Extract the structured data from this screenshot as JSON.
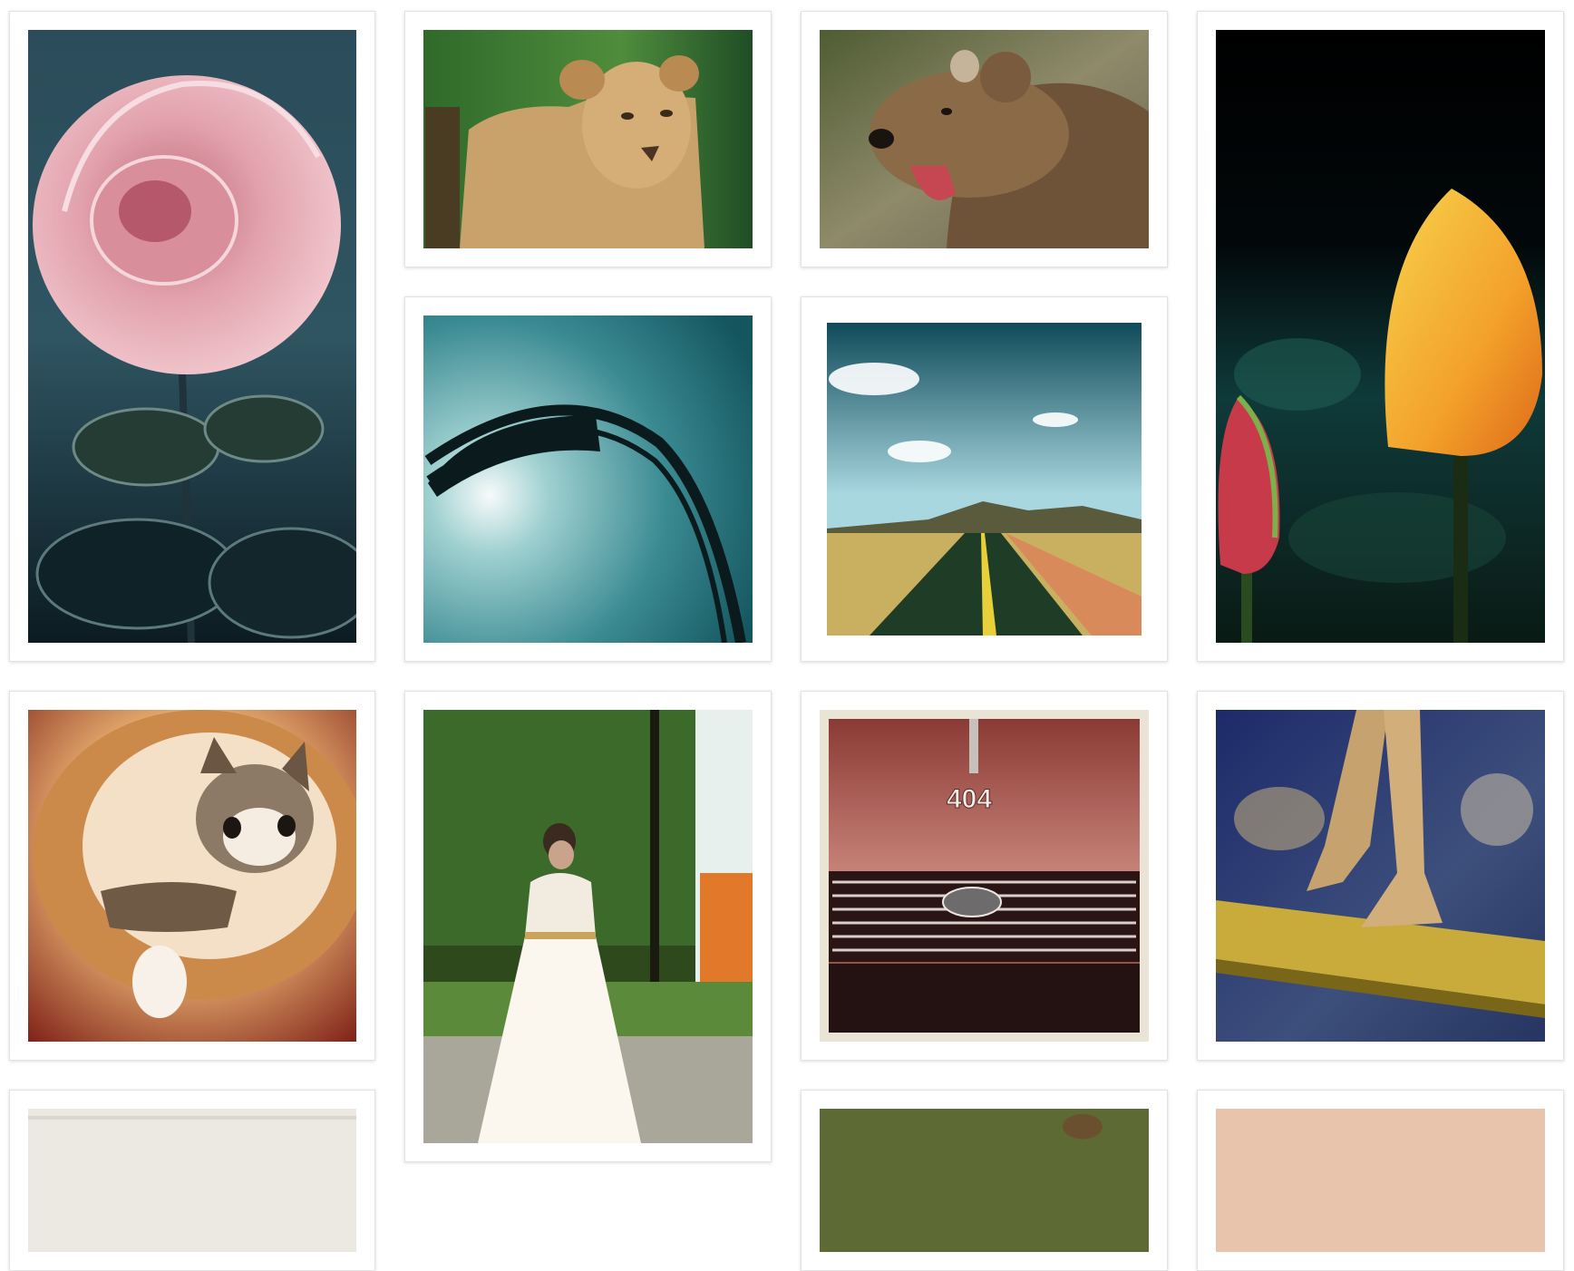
{
  "gallery": {
    "items": [
      {
        "subject": "rose-photo"
      },
      {
        "subject": "lioness-photo"
      },
      {
        "subject": "bear-photo"
      },
      {
        "subject": "tulip-photo"
      },
      {
        "subject": "rollercoaster-photo"
      },
      {
        "subject": "road-photo"
      },
      {
        "subject": "kitten-photo"
      },
      {
        "subject": "bride-photo"
      },
      {
        "subject": "car-grille-photo"
      },
      {
        "subject": "balance-beam-photo"
      },
      {
        "subject": "partial-photo"
      },
      {
        "subject": "partial-photo"
      },
      {
        "subject": "partial-photo"
      }
    ],
    "car_badge_text": "404"
  }
}
